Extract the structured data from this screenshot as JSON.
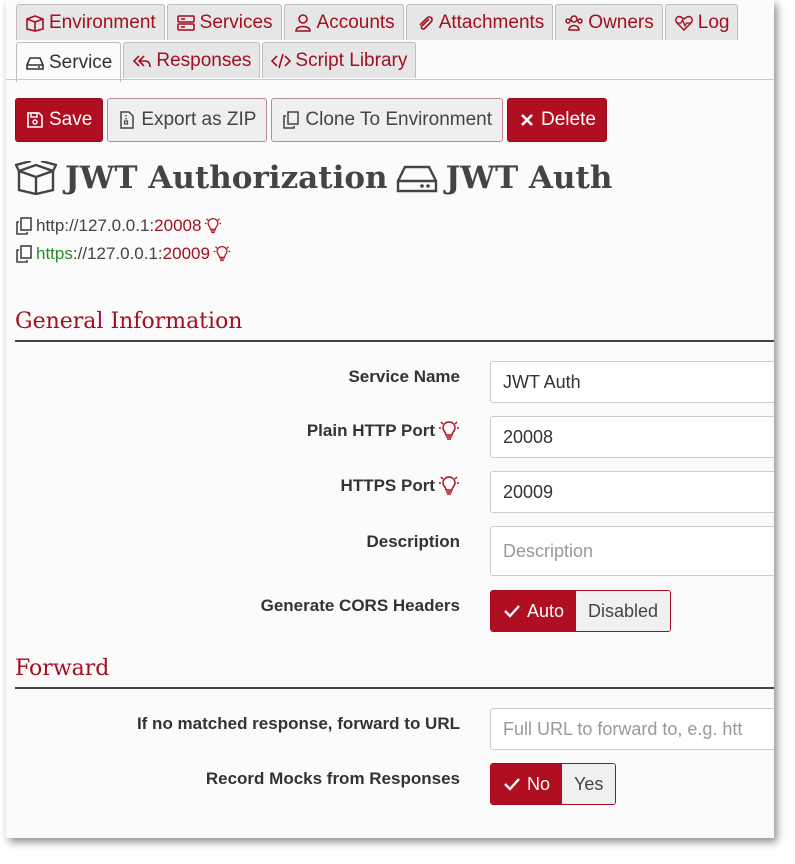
{
  "tabs_row1": [
    {
      "label": "Environment",
      "icon": "box-open-icon"
    },
    {
      "label": "Services",
      "icon": "server-icon"
    },
    {
      "label": "Accounts",
      "icon": "user-icon"
    },
    {
      "label": "Attachments",
      "icon": "paperclip-icon"
    },
    {
      "label": "Owners",
      "icon": "users-icon"
    },
    {
      "label": "Log",
      "icon": "heartbeat-icon"
    }
  ],
  "tabs_row2": [
    {
      "label": "Service",
      "icon": "hdd-icon",
      "active": true
    },
    {
      "label": "Responses",
      "icon": "reply-all-icon"
    },
    {
      "label": "Script Library",
      "icon": "code-icon"
    }
  ],
  "toolbar": {
    "save": "Save",
    "export": "Export as ZIP",
    "clone": "Clone To Environment",
    "delete": "Delete"
  },
  "heading": {
    "environment": "JWT Authorization",
    "service": "JWT Auth"
  },
  "urls": {
    "http": {
      "scheme": "http",
      "host": "://127.0.0.1:",
      "port": "20008"
    },
    "https": {
      "scheme": "https",
      "host": "://127.0.0.1:",
      "port": "20009"
    }
  },
  "sections": {
    "general": "General Information",
    "forward": "Forward"
  },
  "form": {
    "service_name_label": "Service Name",
    "service_name_value": "JWT Auth",
    "http_port_label": "Plain HTTP Port",
    "http_port_value": "20008",
    "https_port_label": "HTTPS Port",
    "https_port_value": "20009",
    "description_label": "Description",
    "description_placeholder": "Description",
    "cors_label": "Generate CORS Headers",
    "cors_on": "Auto",
    "cors_off": "Disabled",
    "forward_label": "If no matched response, forward to URL",
    "forward_placeholder": "Full URL to forward to, e.g. htt",
    "record_label": "Record Mocks from Responses",
    "record_on": "No",
    "record_off": "Yes"
  },
  "colors": {
    "accent": "#b00e21",
    "https": "#2d8a2d"
  }
}
